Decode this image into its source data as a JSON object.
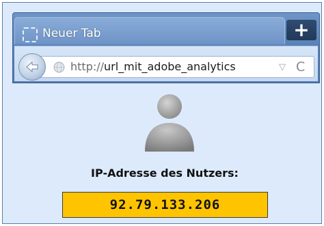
{
  "browser": {
    "tab": {
      "label": "Neuer Tab",
      "icon": "blank-page-icon"
    },
    "new_tab": {
      "label": "+",
      "icon": "plus-icon"
    },
    "nav": {
      "back_icon": "back-arrow-icon",
      "url_prefix": "http://",
      "url_host": "url_mit_adobe_analytics",
      "dropdown_icon": "triangle-down-icon",
      "dropdown_glyph": "▽",
      "reload_icon": "reload-icon",
      "reload_glyph": "C"
    }
  },
  "content": {
    "avatar_icon": "user-avatar-icon",
    "ip_label": "IP-Adresse des Nutzers:",
    "ip_value": "92.79.133.206"
  },
  "colors": {
    "content_bg": "#dceafc",
    "titlebar": "#5a83b8",
    "ip_box_bg": "#ffc400"
  }
}
